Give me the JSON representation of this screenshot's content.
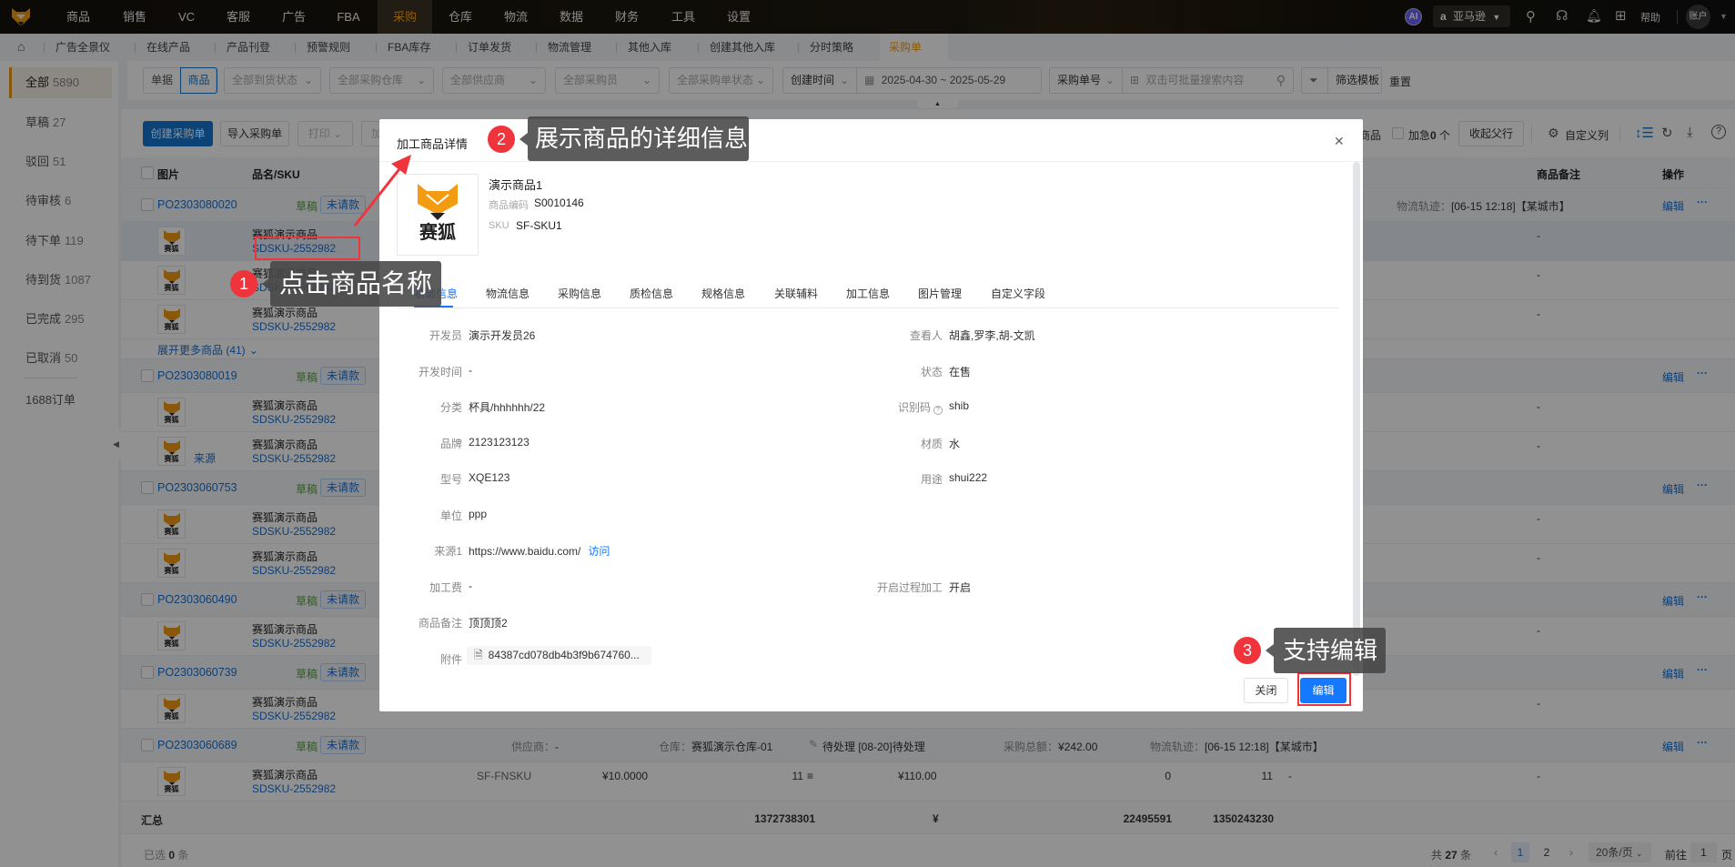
{
  "topnav": {
    "items": [
      "商品",
      "销售",
      "VC",
      "客服",
      "广告",
      "FBA",
      "采购",
      "仓库",
      "物流",
      "数据",
      "财务",
      "工具",
      "设置"
    ],
    "active_index": 6,
    "ai_label": "AI",
    "marketplace": "亚马逊",
    "help": "帮助",
    "account": "账户"
  },
  "tabs": {
    "items": [
      "广告全景仪",
      "在线产品",
      "产品刊登",
      "预警规则",
      "FBA库存",
      "订单发货",
      "物流管理",
      "其他入库",
      "创建其他入库",
      "分时策略"
    ],
    "active": "采购单"
  },
  "sidebar": {
    "items": [
      {
        "label": "全部",
        "count": "5890",
        "help": true
      },
      {
        "label": "草稿",
        "count": "27"
      },
      {
        "label": "驳回",
        "count": "51"
      },
      {
        "label": "待审核",
        "count": "6"
      },
      {
        "label": "待下单",
        "count": "119"
      },
      {
        "label": "待到货",
        "count": "1087"
      },
      {
        "label": "已完成",
        "count": "295"
      },
      {
        "label": "已取消",
        "count": "50"
      },
      {
        "label": "1688订单",
        "count": ""
      }
    ]
  },
  "filters": {
    "mode": [
      "单据",
      "商品"
    ],
    "selects": [
      "全部到货状态",
      "全部采购仓库",
      "全部供应商",
      "全部采购员",
      "全部采购单状态"
    ],
    "date_type": "创建时间",
    "date_range": "2025-04-30 ~ 2025-05-29",
    "search_field": "采购单号",
    "search_placeholder": "双击可批量搜索内容",
    "template": "筛选模板",
    "reset": "重置"
  },
  "toolbar": {
    "create": "创建采购单",
    "import": "导入采购单",
    "print": "打印",
    "partial": "加",
    "goods_suffix": "商品",
    "urgent": "加急",
    "urgent_count": "0",
    "urgent_unit": "个",
    "collapse_parent": "收起父行",
    "custom_columns": "自定义列"
  },
  "table": {
    "headers": {
      "image": "图片",
      "name_sku": "品名/SKU",
      "remark": "商品备注",
      "action": "操作"
    },
    "edit": "编辑",
    "more": "···",
    "status_draft": "草稿",
    "status_unpaid": "未请款",
    "item_name": "赛狐演示商品",
    "item_sku": "SDSKU-2552982",
    "logo_text": "赛狐",
    "source": "来源",
    "dash": "-",
    "logistics_label": "物流轨迹：",
    "logistics_value": "[06-15 12:18]【某城市】",
    "expand_more": "展开更多商品 (41)",
    "orders": [
      {
        "po": "PO2303080020",
        "items": 3,
        "logistics": true,
        "expand": true,
        "highlight_first": true
      },
      {
        "po": "PO2303080019",
        "items": 2,
        "source_on": 1
      },
      {
        "po": "PO2303060753",
        "items": 2
      },
      {
        "po": "PO2303060490",
        "items": 1
      },
      {
        "po": "PO2303060739",
        "items": 1
      },
      {
        "po": "PO2303060689",
        "items": 1,
        "details": {
          "supplier_label": "供应商：",
          "supplier": "-",
          "warehouse_label": "仓库：",
          "warehouse": "赛狐演示仓库-01",
          "pending": "待处理 [08-20]待处理",
          "total_label": "采购总额：",
          "total": "¥242.00",
          "logistics": true
        },
        "item_detail": {
          "fnsku": "SF-FNSKU",
          "price": "¥10.0000",
          "qty": "11",
          "amount": "¥110.00",
          "received": "0",
          "pending": "11",
          "c1": "-",
          "remark": "-"
        }
      }
    ],
    "summary": {
      "label": "汇总",
      "qty": "1372738301",
      "amount": "¥",
      "received": "22495591",
      "pending": "1350243230"
    }
  },
  "footer": {
    "selected_prefix": "已选",
    "selected_count": "0",
    "selected_suffix": "条",
    "total_prefix": "共",
    "total": "27",
    "total_suffix": "条",
    "pages": [
      "1",
      "2"
    ],
    "current_page": "1",
    "page_size": "20条/页",
    "goto": "前往",
    "goto_value": "1",
    "page_unit": "页"
  },
  "modal": {
    "title": "加工商品详情",
    "product_name": "演示商品1",
    "code_label": "商品编码",
    "code": "S0010146",
    "sku_label": "SKU",
    "sku": "SF-SKU1",
    "logo_text": "赛狐",
    "tabs": [
      "基础信息",
      "物流信息",
      "采购信息",
      "质检信息",
      "规格信息",
      "关联辅料",
      "加工信息",
      "图片管理",
      "自定义字段"
    ],
    "active_tab": 0,
    "fields_left": [
      {
        "label": "开发员",
        "value": "演示开发员26"
      },
      {
        "label": "开发时间",
        "value": "-"
      },
      {
        "label": "分类",
        "value": "杯具/hhhhhh/22"
      },
      {
        "label": "品牌",
        "value": "2123123123"
      },
      {
        "label": "型号",
        "value": "XQE123"
      },
      {
        "label": "单位",
        "value": "ppp"
      },
      {
        "label": "来源1",
        "value": "https://www.baidu.com/",
        "link": "访问"
      },
      {
        "label": "加工费",
        "value": "-"
      },
      {
        "label": "商品备注",
        "value": "顶顶顶2"
      },
      {
        "label": "附件",
        "value": "84387cd078db4b3f9b674760...",
        "file": true
      }
    ],
    "fields_right": [
      {
        "label": "查看人",
        "value": "胡鑫,罗李,胡-文凯"
      },
      {
        "label": "状态",
        "value": "在售"
      },
      {
        "label": "识别码",
        "value": "shib",
        "help": true
      },
      {
        "label": "材质",
        "value": "水"
      },
      {
        "label": "用途",
        "value": "shui222"
      },
      null,
      null,
      {
        "label": "开启过程加工",
        "value": "开启"
      }
    ],
    "close": "关闭",
    "edit": "编辑"
  },
  "annotations": [
    {
      "num": "1",
      "text": "点击商品名称"
    },
    {
      "num": "2",
      "text": "展示商品的详细信息"
    },
    {
      "num": "3",
      "text": "支持编辑"
    }
  ],
  "colors": {
    "accent": "#f39c12",
    "link": "#1a6fd1",
    "primary": "#1677ff",
    "annotation": "#f0343b"
  }
}
